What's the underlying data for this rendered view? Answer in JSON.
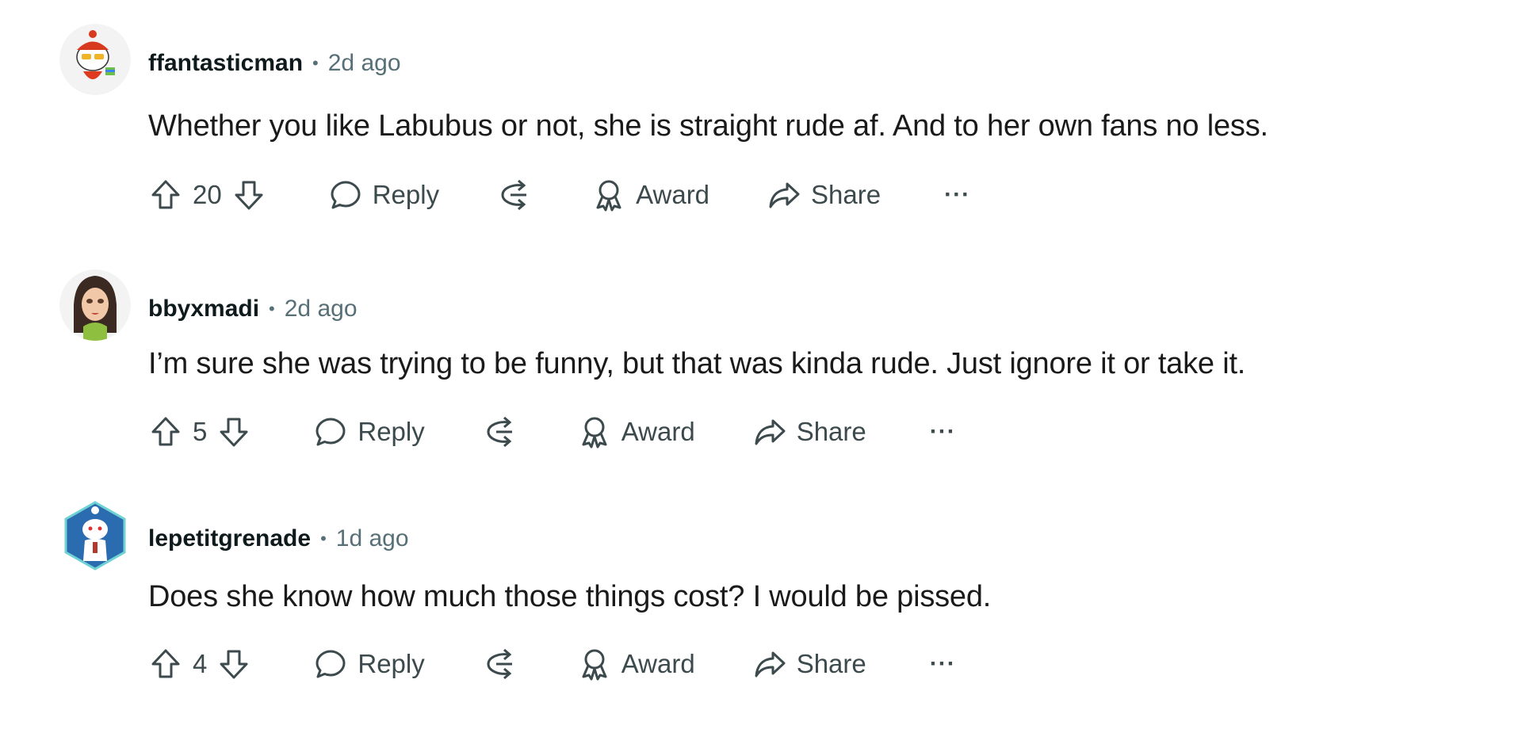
{
  "comments": [
    {
      "username": "ffantasticman",
      "separator": "•",
      "time": "2d ago",
      "text": "Whether you like Labubus or not, she is straight rude af. And to her own fans no less.",
      "votes": "20",
      "reply_label": "Reply",
      "award_label": "Award",
      "share_label": "Share",
      "more_label": "···",
      "avatar_icon": "snoo-avatar-sunglasses-icon"
    },
    {
      "username": "bbyxmadi",
      "separator": "•",
      "time": "2d ago",
      "text": "I’m sure she was trying to be funny, but that was kinda rude. Just ignore it or take it.",
      "votes": "5",
      "reply_label": "Reply",
      "award_label": "Award",
      "share_label": "Share",
      "more_label": "···",
      "avatar_icon": "doll-avatar-icon"
    },
    {
      "username": "lepetitgrenade",
      "separator": "•",
      "time": "1d ago",
      "text": "Does she know how much those things cost? I would be pissed.",
      "votes": "4",
      "reply_label": "Reply",
      "award_label": "Award",
      "share_label": "Share",
      "more_label": "···",
      "avatar_icon": "snoo-avatar-hexagon-icon"
    }
  ],
  "colors": {
    "text_primary": "#1a1a1b",
    "text_meta": "#576f76",
    "action_text": "#3c4a4d"
  }
}
